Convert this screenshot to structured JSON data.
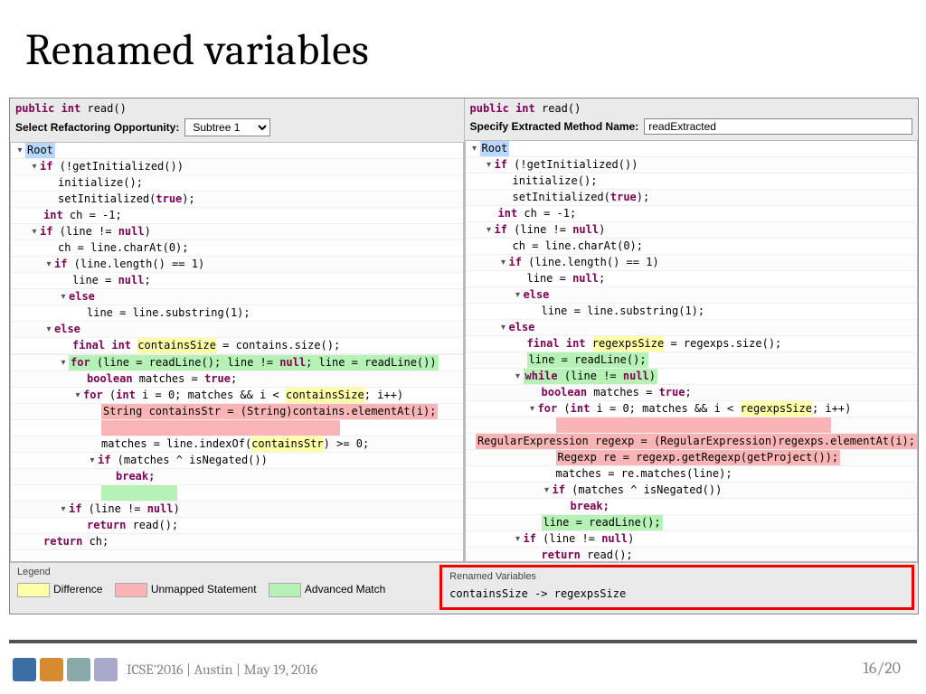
{
  "title": "Renamed variables",
  "left": {
    "signature": "public int read()",
    "select_label": "Select Refactoring Opportunity:",
    "select_value": "Subtree 1",
    "root": "Root"
  },
  "right": {
    "signature": "public int read()",
    "input_label": "Specify Extracted Method Name:",
    "input_value": "readExtracted",
    "root": "Root"
  },
  "code_left": {
    "l1a": "if",
    "l1b": " (!getInitialized())",
    "l2": "initialize();",
    "l3a": "setInitialized(",
    "l3b": "true",
    "l3c": ");",
    "l4a": "int",
    "l4b": " ch = -1;",
    "l5a": "if",
    "l5b": " (line != ",
    "l5c": "null",
    "l5d": ")",
    "l6": "ch = line.charAt(0);",
    "l7a": "if",
    "l7b": " (line.length() == 1)",
    "l8a": "line = ",
    "l8b": "null",
    "l8c": ";",
    "l9": "else",
    "l10": "line = line.substring(1);",
    "l11": "else",
    "l12a": "final int ",
    "l12b": "containsSize",
    "l12c": " = contains.size();",
    "l13a": "for",
    "l13b": " (line = readLine(); line != ",
    "l13c": "null",
    "l13d": "; line = readLine())",
    "l14a": "boolean",
    "l14b": " matches = ",
    "l14c": "true",
    "l14d": ";",
    "l15a": "for",
    "l15b": " (",
    "l15c": "int",
    "l15d": " i = 0; matches && i < ",
    "l15e": "containsSize",
    "l15f": "; i++)",
    "l16": "String containsStr = (String)contains.elementAt(i);",
    "l17a": "matches = line.indexOf(",
    "l17b": "containsStr",
    "l17c": ") >= 0;",
    "l18a": "if",
    "l18b": " (matches ^ isNegated())",
    "l19": "break;",
    "l20a": "if",
    "l20b": " (line != ",
    "l20c": "null",
    "l20d": ")",
    "l21a": "return",
    "l21b": " read();",
    "l22a": "return",
    "l22b": " ch;"
  },
  "code_right": {
    "l1a": "if",
    "l1b": " (!getInitialized())",
    "l2": "initialize();",
    "l3a": "setInitialized(",
    "l3b": "true",
    "l3c": ");",
    "l4a": "int",
    "l4b": " ch = -1;",
    "l5a": "if",
    "l5b": " (line != ",
    "l5c": "null",
    "l5d": ")",
    "l6": "ch = line.charAt(0);",
    "l7a": "if",
    "l7b": " (line.length() == 1)",
    "l8a": "line = ",
    "l8b": "null",
    "l8c": ";",
    "l9": "else",
    "l10": "line = line.substring(1);",
    "l11": "else",
    "l12a": "final int ",
    "l12b": "regexpsSize",
    "l12c": " = regexps.size();",
    "l12x": "line = readLine();",
    "l13a": "while",
    "l13b": " (line != ",
    "l13c": "null",
    "l13d": ")",
    "l14a": "boolean",
    "l14b": " matches = ",
    "l14c": "true",
    "l14d": ";",
    "l15a": "for",
    "l15b": " (",
    "l15c": "int",
    "l15d": " i = 0; matches && i < ",
    "l15e": "regexpsSize",
    "l15f": "; i++)",
    "l16a": "RegularExpression regexp = (RegularExpression)regexps.elementAt(i);",
    "l16b": "Regexp re = regexp.getRegexp(getProject());",
    "l17": "matches = re.matches(line);",
    "l18a": "if",
    "l18b": " (matches ^ isNegated())",
    "l19": "break;",
    "l19x": "line = readLine();",
    "l20a": "if",
    "l20b": " (line != ",
    "l20c": "null",
    "l20d": ")",
    "l21a": "return",
    "l21b": " read();",
    "l22a": "return",
    "l22b": " ch;"
  },
  "legend": {
    "title": "Legend",
    "diff": "Difference",
    "unmapped": "Unmapped Statement",
    "adv": "Advanced Match"
  },
  "renamed": {
    "title": "Renamed Variables",
    "body": "containsSize -> regexpsSize"
  },
  "footer": {
    "text": "ICSE'2016 | Austin | May 19, 2016",
    "page_cur": "16",
    "page_sep": "/",
    "page_tot": "20"
  }
}
